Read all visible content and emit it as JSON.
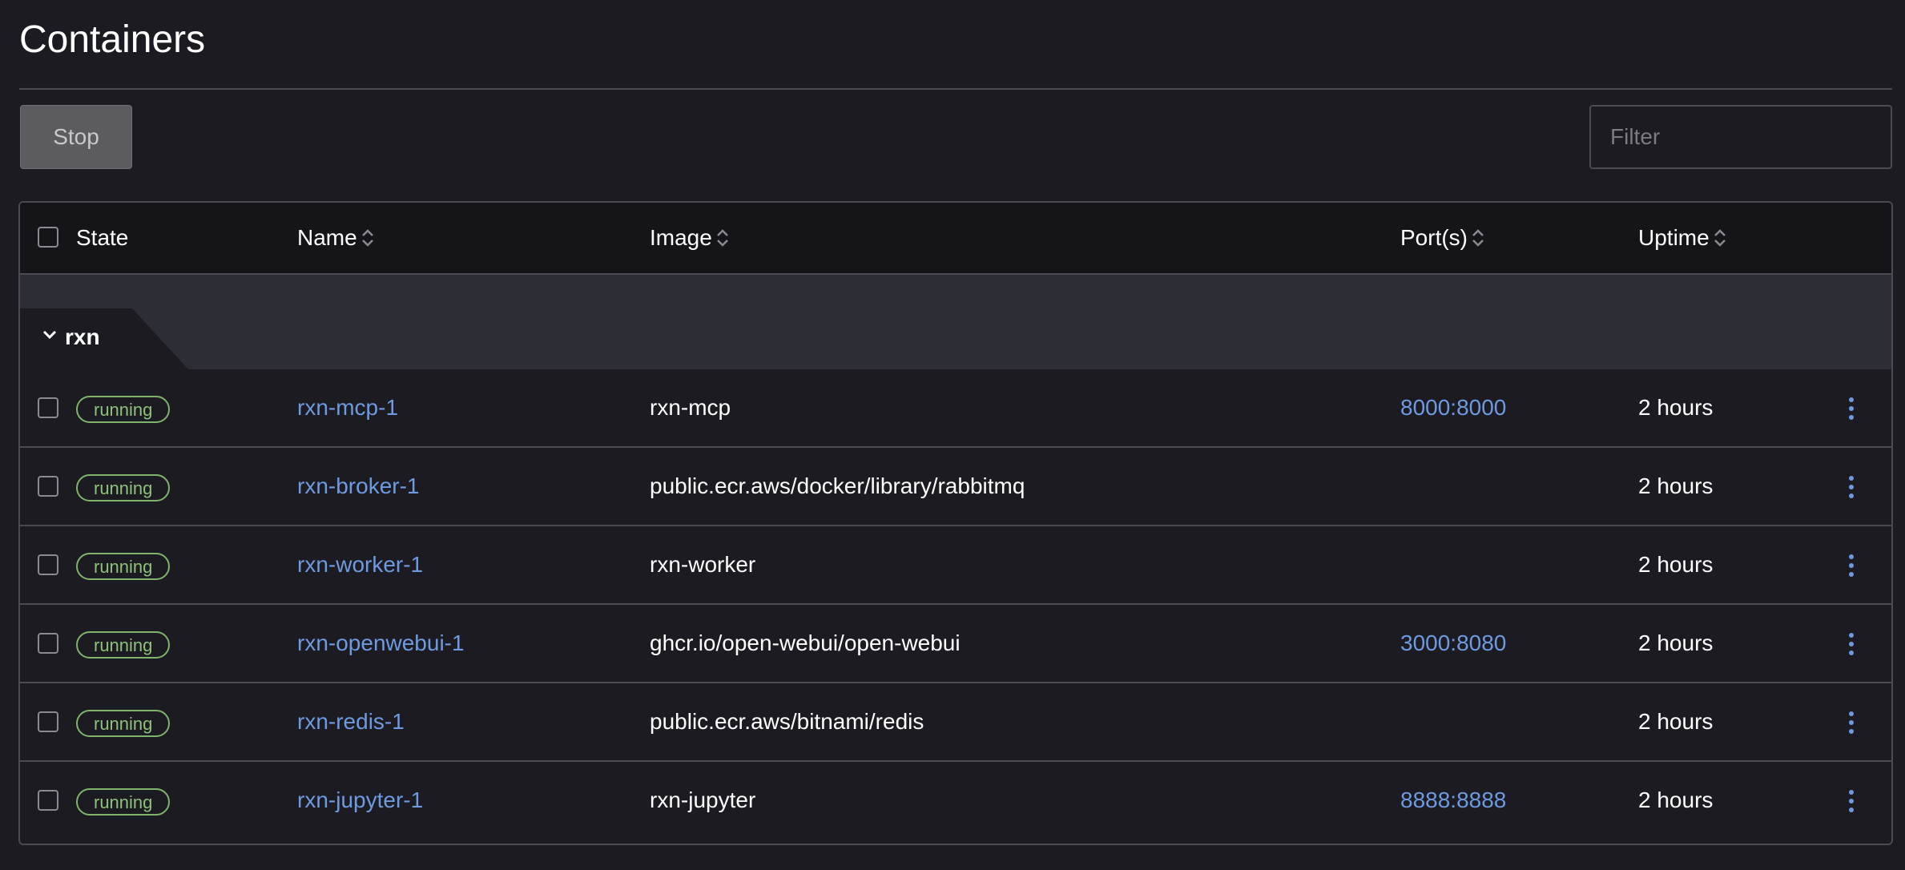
{
  "page": {
    "title": "Containers"
  },
  "toolbar": {
    "stop_label": "Stop",
    "filter_placeholder": "Filter"
  },
  "table": {
    "columns": {
      "state": "State",
      "name": "Name",
      "image": "Image",
      "ports": "Port(s)",
      "uptime": "Uptime"
    },
    "group": {
      "label": "rxn"
    },
    "rows": [
      {
        "state": "running",
        "name": "rxn-mcp-1",
        "image": "rxn-mcp",
        "ports": "8000:8000",
        "uptime": "2 hours"
      },
      {
        "state": "running",
        "name": "rxn-broker-1",
        "image": "public.ecr.aws/docker/library/rabbitmq",
        "ports": "",
        "uptime": "2 hours"
      },
      {
        "state": "running",
        "name": "rxn-worker-1",
        "image": "rxn-worker",
        "ports": "",
        "uptime": "2 hours"
      },
      {
        "state": "running",
        "name": "rxn-openwebui-1",
        "image": "ghcr.io/open-webui/open-webui",
        "ports": "3000:8080",
        "uptime": "2 hours"
      },
      {
        "state": "running",
        "name": "rxn-redis-1",
        "image": "public.ecr.aws/bitnami/redis",
        "ports": "",
        "uptime": "2 hours"
      },
      {
        "state": "running",
        "name": "rxn-jupyter-1",
        "image": "rxn-jupyter",
        "ports": "8888:8888",
        "uptime": "2 hours"
      }
    ]
  },
  "colors": {
    "background": "#1b1b21",
    "header_background": "#141419",
    "group_background": "#2d2d35",
    "link": "#6e9ae0",
    "status_running": "#8dc17a",
    "border": "#4a4a52"
  },
  "icons": {
    "sort": "sort-icon",
    "group_toggle": "chevron-down-icon",
    "row_actions": "kebab-menu-icon"
  }
}
